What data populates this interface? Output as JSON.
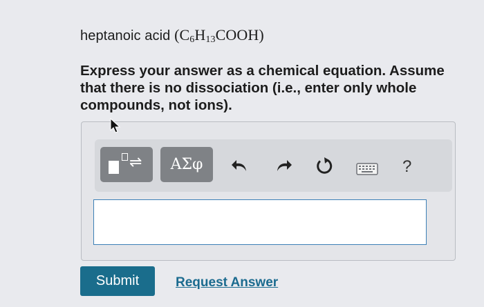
{
  "question": {
    "name": "heptanoic acid",
    "formula": {
      "c": "C",
      "c_sub": "6",
      "h": "H",
      "h_sub": "13",
      "tail": "COOH"
    }
  },
  "instructions": "Express your answer as a chemical equation. Assume that there is no dissociation (i.e., enter only whole compounds, not ions).",
  "toolbar": {
    "template_icon": "fraction-template-icon",
    "greek_label": "ΑΣφ",
    "undo_icon": "undo-icon",
    "redo_icon": "redo-icon",
    "reset_icon": "reset-icon",
    "keyboard_icon": "keyboard-icon",
    "help_label": "?"
  },
  "answer_input": {
    "value": ""
  },
  "submit_label": "Submit",
  "request_answer_label": "Request Answer",
  "colors": {
    "accent": "#1a6d8c",
    "link": "#1b6b8f",
    "input_border": "#3b7fb6",
    "toolbar_button": "#7f8286"
  }
}
